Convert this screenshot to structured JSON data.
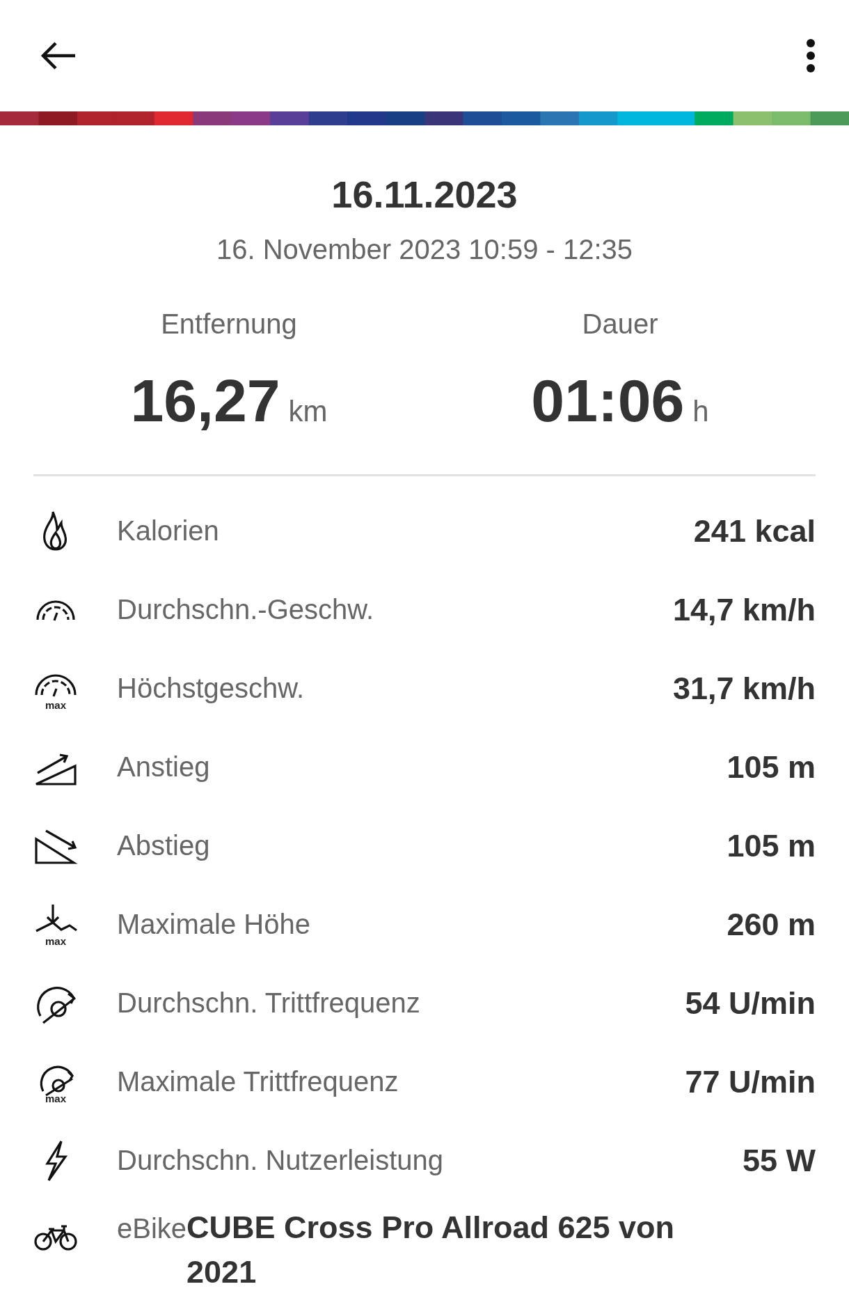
{
  "header": {
    "date": "16.11.2023",
    "time_range": "16. November 2023 10:59 - 12:35"
  },
  "summary": [
    {
      "label": "Entfernung",
      "value": "16,27",
      "unit": "km"
    },
    {
      "label": "Dauer",
      "value": "01:06",
      "unit": "h"
    }
  ],
  "stats": [
    {
      "kind": "stat",
      "label": "Kalorien",
      "value": "241 kcal"
    },
    {
      "kind": "stat",
      "label": "Durchschn.-Geschw.",
      "value": "14,7 km/h"
    },
    {
      "kind": "stat",
      "label": "Höchstgeschw.",
      "value": "31,7 km/h",
      "icon_badge": "max"
    },
    {
      "kind": "stat",
      "label": "Anstieg",
      "value": "105 m"
    },
    {
      "kind": "stat",
      "label": "Abstieg",
      "value": "105 m"
    },
    {
      "kind": "stat",
      "label": "Maximale Höhe",
      "value": "260 m",
      "icon_badge": "max"
    },
    {
      "kind": "stat",
      "label": "Durchschn. Trittfrequenz",
      "value": "54 U/min"
    },
    {
      "kind": "stat",
      "label": "Maximale Trittfrequenz",
      "value": "77 U/min",
      "icon_badge": "max"
    },
    {
      "kind": "stat",
      "label": "Durchschn. Nutzerleistung",
      "value": "55 W"
    },
    {
      "kind": "bike",
      "label": "eBike",
      "value": "CUBE Cross Pro Allroad 625 von 2021"
    }
  ]
}
